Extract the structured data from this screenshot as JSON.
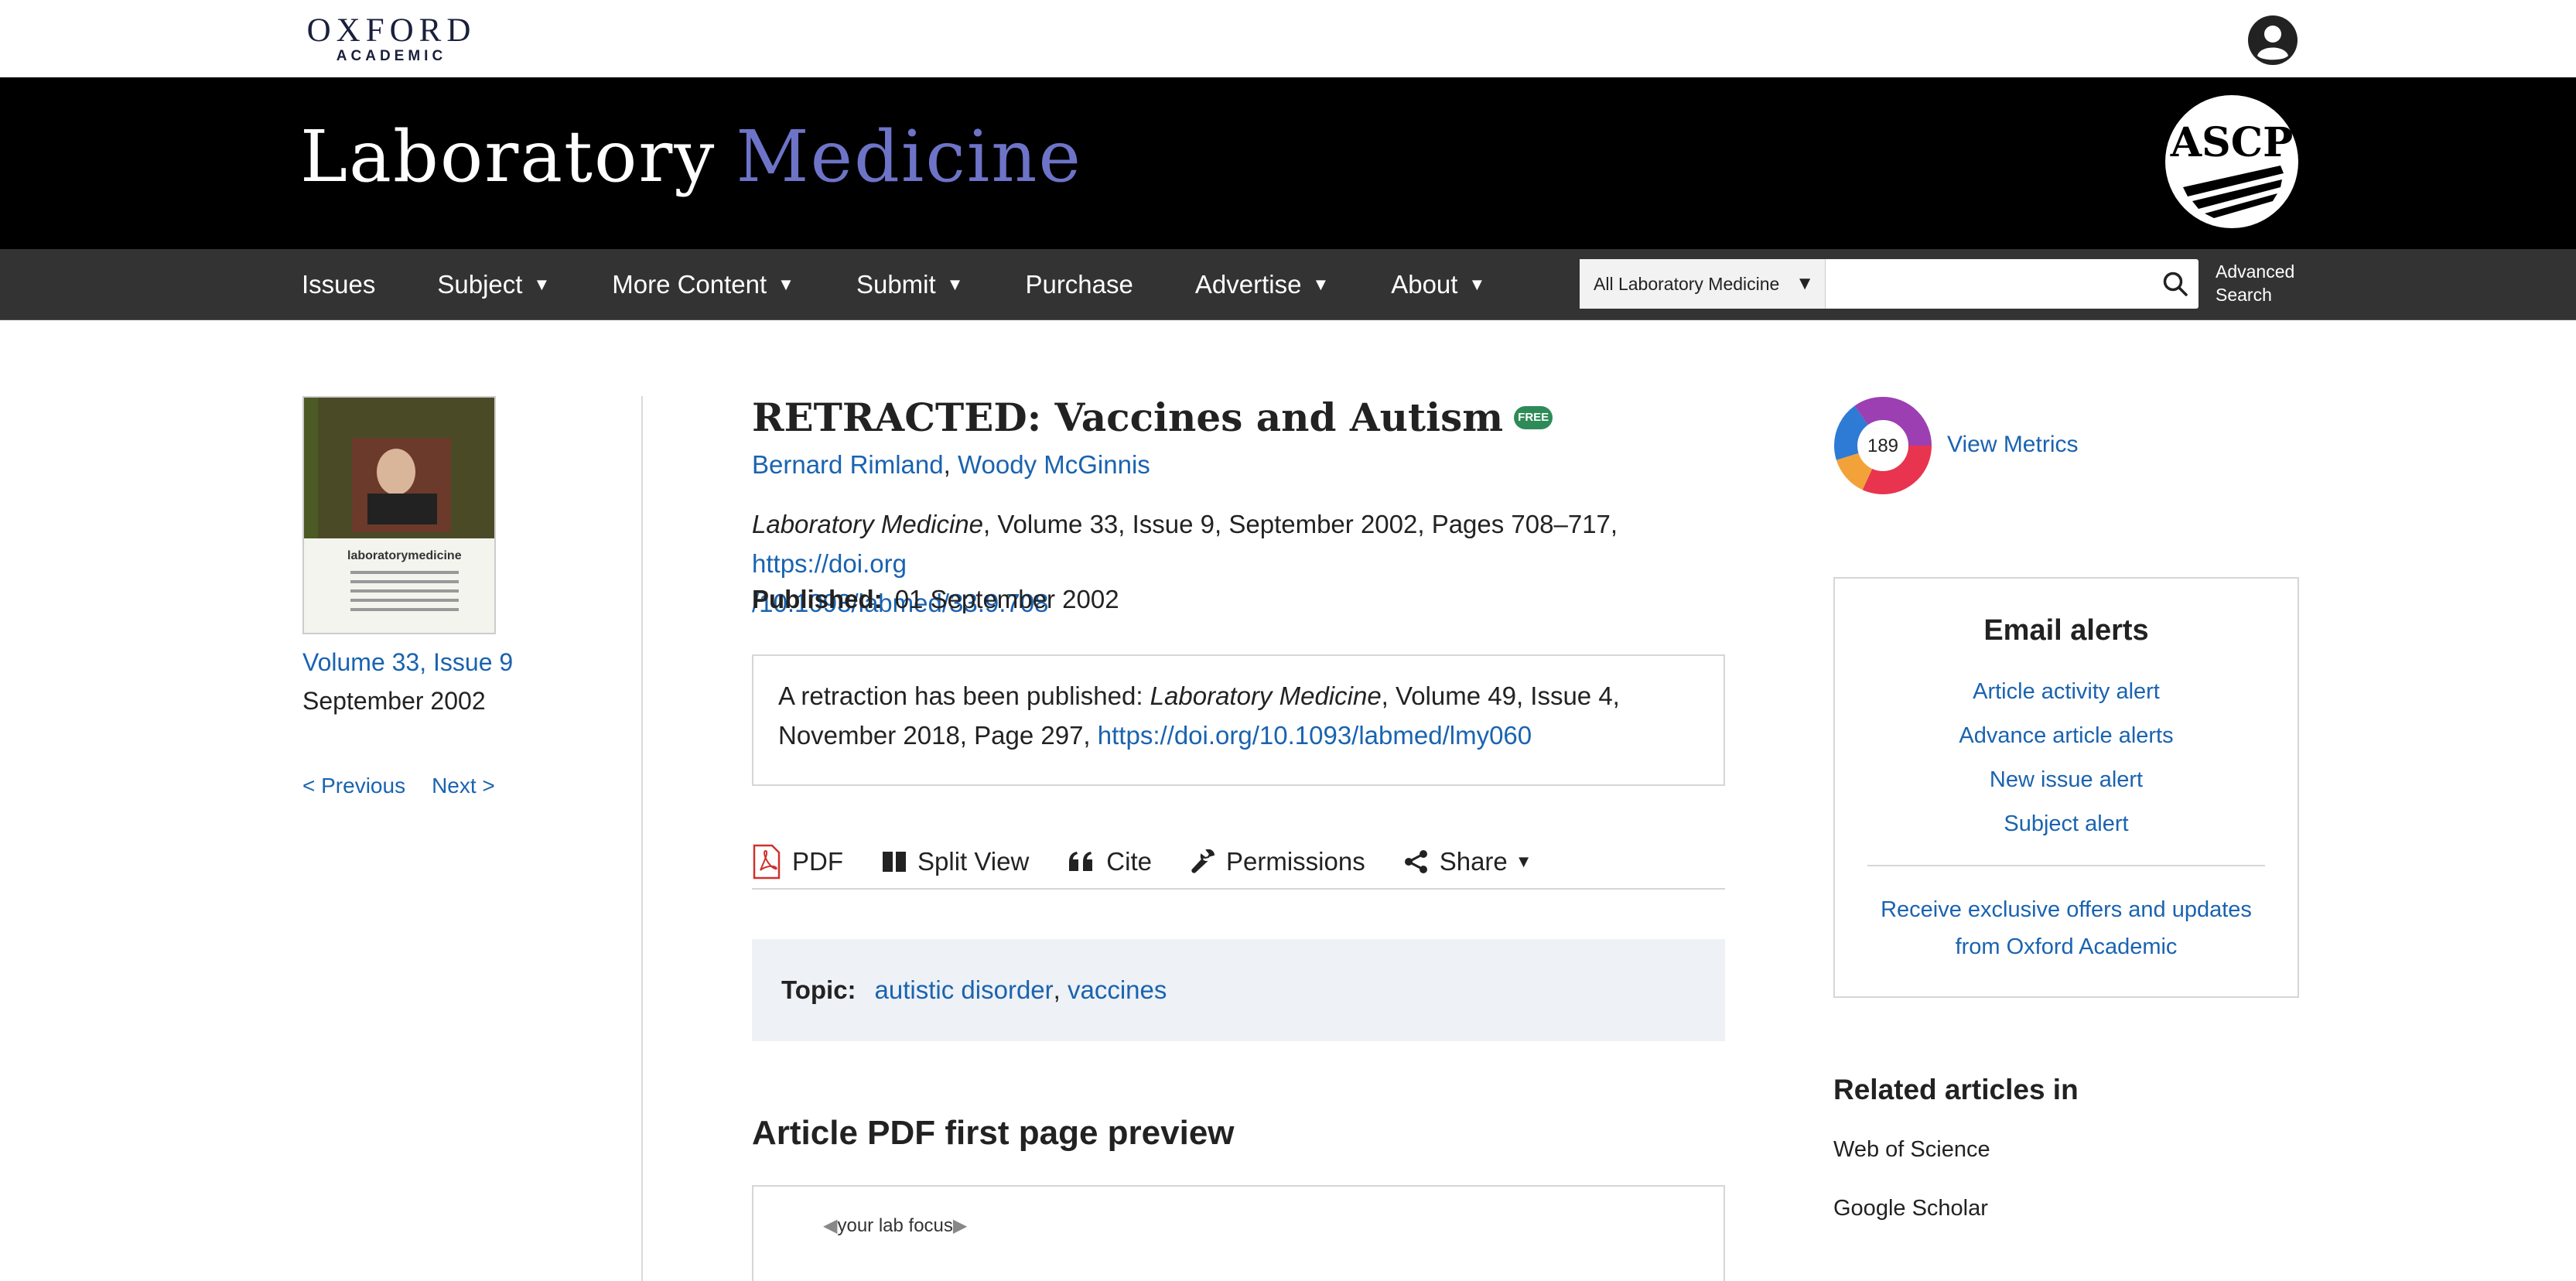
{
  "header": {
    "publisher_main": "OXFORD",
    "publisher_sub": "ACADEMIC",
    "account_icon": "account-circle-icon"
  },
  "banner": {
    "journal_title_part1": "Laboratory",
    "journal_title_part2": "Medicine",
    "society_logo_text": "ASCP",
    "colors": {
      "background": "#000000",
      "title": "#ffffff",
      "title_accent": "#6d74c8"
    }
  },
  "nav": {
    "items": [
      {
        "label": "Issues",
        "has_dropdown": false
      },
      {
        "label": "Subject",
        "has_dropdown": true
      },
      {
        "label": "More Content",
        "has_dropdown": true
      },
      {
        "label": "Submit",
        "has_dropdown": true
      },
      {
        "label": "Purchase",
        "has_dropdown": false
      },
      {
        "label": "Advertise",
        "has_dropdown": true
      },
      {
        "label": "About",
        "has_dropdown": true
      }
    ],
    "search": {
      "scope_selected": "All Laboratory Medicine",
      "query": "",
      "icon": "search-icon"
    },
    "advanced_search_line1": "Advanced",
    "advanced_search_line2": "Search"
  },
  "issue": {
    "cover_brand": "laboratorymedicine",
    "volume_issue": "Volume 33, Issue 9",
    "date": "September 2002",
    "prev_label": "< Previous",
    "next_label": "Next >"
  },
  "article": {
    "title": "RETRACTED: Vaccines and Autism",
    "free_badge": "FREE",
    "authors": [
      "Bernard Rimland",
      "Woody McGinnis"
    ],
    "author_separator": ",",
    "citation_journal": "Laboratory Medicine",
    "citation_details": ", Volume 33, Issue 9, September 2002, Pages 708–717, ",
    "doi_part1": "https://doi.org",
    "doi_part2": "/10.1093/labmed/33.9.708",
    "published_label": "Published:",
    "published_date": "01 September 2002",
    "retraction_prefix": "A retraction has been published: ",
    "retraction_journal": "Laboratory Medicine",
    "retraction_details": ", Volume 49, Issue 4, November 2018, Page 297, ",
    "retraction_doi": "https://doi.org/10.1093/labmed/lmy060"
  },
  "toolbar": {
    "pdf_label": "PDF",
    "split_view_label": "Split View",
    "cite_label": "Cite",
    "permissions_label": "Permissions",
    "share_label": "Share"
  },
  "topic": {
    "label": "Topic:",
    "items": [
      "autistic disorder",
      "vaccines"
    ],
    "separator": ","
  },
  "preview": {
    "heading": "Article PDF first page preview",
    "snippet": "your lab focus"
  },
  "metrics": {
    "altmetric_score": "189",
    "view_metrics_label": "View Metrics"
  },
  "email_alerts": {
    "title": "Email alerts",
    "links": [
      "Article activity alert",
      "Advance article alerts",
      "New issue alert",
      "Subject alert"
    ],
    "offer_line1": "Receive exclusive offers and updates",
    "offer_line2": "from Oxford Academic"
  },
  "related": {
    "heading": "Related articles in",
    "links": [
      "Web of Science",
      "Google Scholar"
    ]
  },
  "colors": {
    "link": "#1a63b0",
    "navbar": "#333333",
    "topic_bg": "#eef1f5",
    "free_badge": "#2e8b57"
  }
}
